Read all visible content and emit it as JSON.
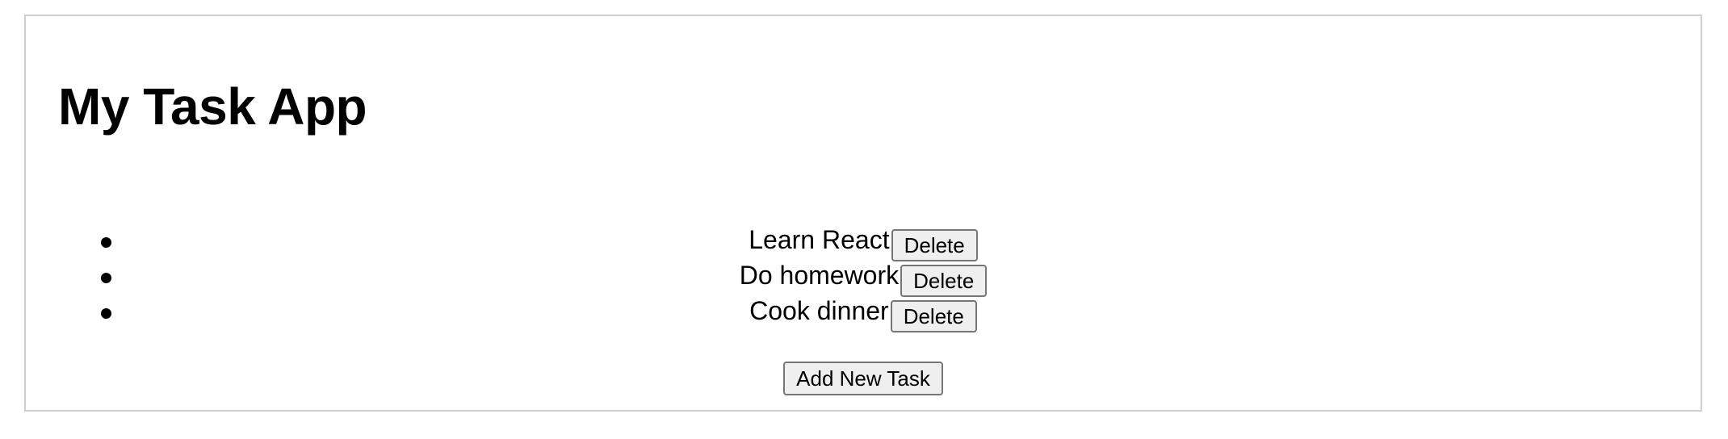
{
  "app": {
    "title": "My Task App",
    "add_button_label": "Add New Task"
  },
  "tasks": [
    {
      "text": "Learn React",
      "delete_label": "Delete"
    },
    {
      "text": "Do homework",
      "delete_label": "Delete"
    },
    {
      "text": "Cook dinner",
      "delete_label": "Delete"
    }
  ],
  "colors": {
    "border": "#cfcfcf",
    "button_bg": "#efefef",
    "button_border": "#767676",
    "text": "#000000"
  }
}
